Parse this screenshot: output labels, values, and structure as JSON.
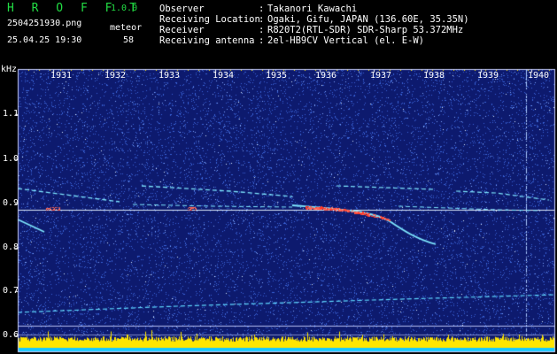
{
  "app": {
    "name": "H R O F F T",
    "version": "1.0.0"
  },
  "file": {
    "filename": "2504251930.png",
    "datetime": "25.04.25 19:30"
  },
  "meteor": {
    "label": "meteor",
    "count": "58"
  },
  "station": {
    "separator": ":",
    "rows": [
      {
        "label": "Observer",
        "value": "Takanori Kawachi"
      },
      {
        "label": "Receiving Location",
        "value": "Ogaki, Gifu, JAPAN (136.60E, 35.35N)"
      },
      {
        "label": "Receiver",
        "value": "R820T2(RTL-SDR) SDR-Sharp 53.372MHz"
      },
      {
        "label": "Receiving antenna",
        "value": "2el-HB9CV Vertical (el. E-W)"
      }
    ]
  },
  "axes": {
    "unit": "kHz",
    "y_ticks": [
      "1.1",
      "1.0",
      "0.9",
      "0.8",
      "0.7",
      "0.6"
    ],
    "x_ticks": [
      "1931",
      "1932",
      "1933",
      "1934",
      "1935",
      "1936",
      "1937",
      "1938",
      "1939",
      "1940"
    ]
  },
  "colors": {
    "background": "#000000",
    "plot_background": "#0d1a6e",
    "noise": "#3a64d8",
    "trace": "#7fe8ff",
    "meteor_head": "#ff6a5a",
    "level_bar": "#ffe600",
    "level_base": "#18c8ff",
    "grid": "#c8d0ff",
    "title": "#22dd44"
  }
}
